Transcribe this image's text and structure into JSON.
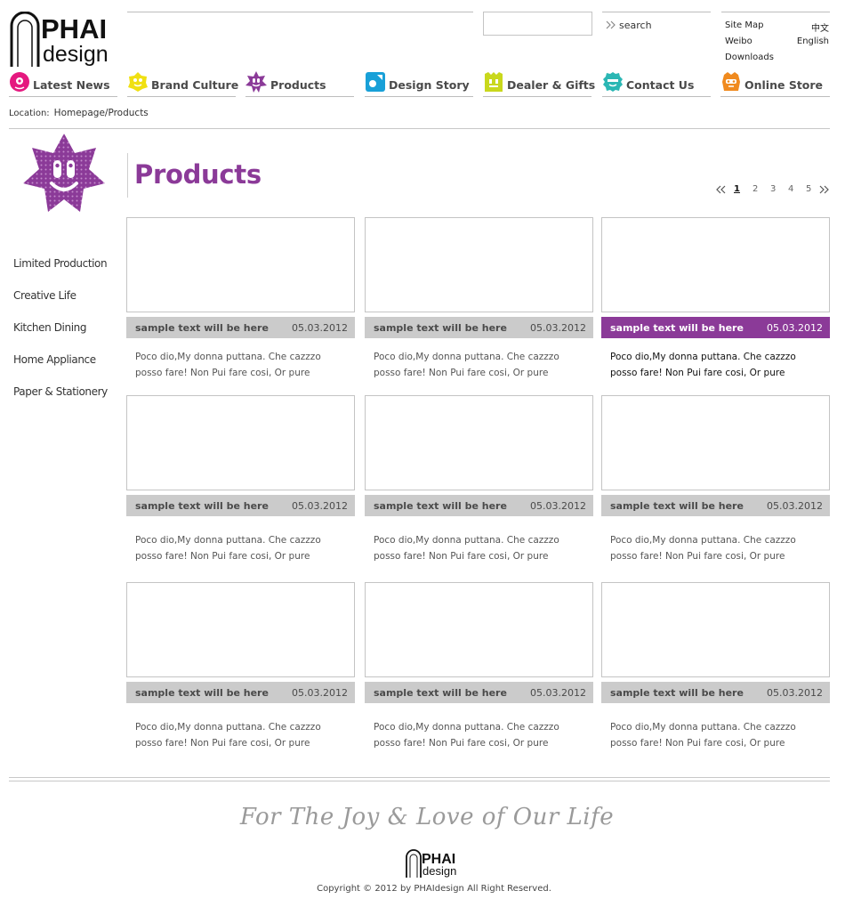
{
  "brand": {
    "logo_top": "PHAI",
    "logo_bottom": "design"
  },
  "search": {
    "value": "",
    "placeholder": "",
    "button_label": "search"
  },
  "utility": {
    "site_map": "Site Map",
    "chinese": "中文",
    "weibo": "Weibo",
    "english": "English",
    "downloads": "Downloads"
  },
  "nav": [
    {
      "label": "Latest News",
      "color": "#e5187f"
    },
    {
      "label": "Brand Culture",
      "color": "#f0e012"
    },
    {
      "label": "Products",
      "color": "#8b3a98"
    },
    {
      "label": "Design Story",
      "color": "#18a0d8"
    },
    {
      "label": "Dealer & Gifts",
      "color": "#c9d81c"
    },
    {
      "label": "Contact Us",
      "color": "#2bb7b4"
    },
    {
      "label": "Online Store",
      "color": "#f08a1e"
    }
  ],
  "location": {
    "label": "Location:",
    "path": "Homepage/Products"
  },
  "page_title": "Products",
  "accent_color": "#8b3a98",
  "pager": {
    "pages": [
      "1",
      "2",
      "3",
      "4",
      "5"
    ],
    "current": "1"
  },
  "sidebar": [
    "Limited Production",
    "Creative Life",
    "Kitchen Dining",
    "Home Appliance",
    "Paper & Stationery"
  ],
  "products": [
    {
      "title": "sample text will be here",
      "date": "05.03.2012",
      "desc": "Poco dio,My donna puttana. Che cazzzo posso fare! Non Pui fare cosi, Or pure"
    },
    {
      "title": "sample text will be here",
      "date": "05.03.2012",
      "desc": "Poco dio,My donna puttana. Che cazzzo posso fare! Non Pui fare cosi, Or pure"
    },
    {
      "title": "sample text will be here",
      "date": "05.03.2012",
      "desc": "Poco dio,My donna puttana. Che cazzzo posso fare! Non Pui fare cosi, Or pure"
    },
    {
      "title": "sample text will be here",
      "date": "05.03.2012",
      "desc": "Poco dio,My donna puttana. Che cazzzo posso fare! Non Pui fare cosi, Or pure"
    },
    {
      "title": "sample text will be here",
      "date": "05.03.2012",
      "desc": "Poco dio,My donna puttana. Che cazzzo posso fare! Non Pui fare cosi, Or pure"
    },
    {
      "title": "sample text will be here",
      "date": "05.03.2012",
      "desc": "Poco dio,My donna puttana. Che cazzzo posso fare! Non Pui fare cosi, Or pure"
    },
    {
      "title": "sample text will be here",
      "date": "05.03.2012",
      "desc": "Poco dio,My donna puttana. Che cazzzo posso fare! Non Pui fare cosi, Or pure"
    },
    {
      "title": "sample text will be here",
      "date": "05.03.2012",
      "desc": "Poco dio,My donna puttana. Che cazzzo posso fare! Non Pui fare cosi, Or pure"
    },
    {
      "title": "sample text will be here",
      "date": "05.03.2012",
      "desc": "Poco dio,My donna puttana. Che cazzzo posso fare! Non Pui fare cosi, Or pure"
    }
  ],
  "footer": {
    "slogan": "For The Joy & Love of Our Life",
    "logo_top": "PHAI",
    "logo_bottom": "design",
    "copyright": "Copyright © 2012 by PHAIdesign All Right Reserved."
  }
}
